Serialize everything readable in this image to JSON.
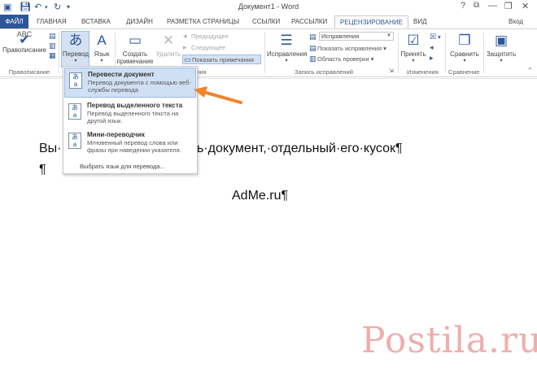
{
  "window": {
    "title": "Документ1 - Word",
    "help": "?",
    "minimize": "—",
    "restore": "❐",
    "close": "✕"
  },
  "quick_access": {
    "save_icon": "save-icon",
    "undo_icon": "undo-icon",
    "redo_icon": "redo-icon",
    "customize_icon": "chevron-down-icon"
  },
  "tabs": [
    {
      "label": "ФАЙЛ"
    },
    {
      "label": "ГЛАВНАЯ"
    },
    {
      "label": "ВСТАВКА"
    },
    {
      "label": "ДИЗАЙН"
    },
    {
      "label": "РАЗМЕТКА СТРАНИЦЫ"
    },
    {
      "label": "ССЫЛКИ"
    },
    {
      "label": "РАССЫЛКИ"
    },
    {
      "label": "РЕЦЕНЗИРОВАНИЕ"
    },
    {
      "label": "ВИД"
    }
  ],
  "user": {
    "label": "Вход"
  },
  "ribbon": {
    "spelling": {
      "label": "Правописание",
      "badge": "ABC"
    },
    "translate": {
      "label": "Перевод"
    },
    "language": {
      "label": "Язык"
    },
    "new_comment": {
      "label1": "Создать",
      "label2": "примечание"
    },
    "delete": {
      "label": "Удалить"
    },
    "prev": {
      "label": "Предыдущее"
    },
    "next": {
      "label": "Следующее"
    },
    "show_comments": {
      "label": "Показать примечания"
    },
    "track_changes": {
      "label": "Исправления"
    },
    "markup_combo": {
      "value": "Исправления"
    },
    "show_markup": {
      "label": "Показать исправления"
    },
    "review_pane": {
      "label": "Область проверки"
    },
    "accept": {
      "label": "Принять"
    },
    "compare": {
      "label": "Сравнить"
    },
    "protect": {
      "label": "Защитить"
    },
    "groups": {
      "proofing": "Правописание",
      "comments_tail": "ения",
      "tracking": "Запись исправлений",
      "changes": "Изменения",
      "compare": "Сравнение"
    }
  },
  "menu": {
    "items": [
      {
        "title": "Перевести документ",
        "desc": "Перевод документа с помощью веб-службы перевода"
      },
      {
        "title": "Перевод выделенного текста",
        "desc": "Перевод выделенного текста на другой язык."
      },
      {
        "title": "Мини-переводчик",
        "desc": "Мгновенный перевод слова или фразы при наведении указателя."
      }
    ],
    "choose_language": "Выбрать язык для перевода..."
  },
  "document": {
    "line1_prefix": "Вы·",
    "line1_suffix": "ь·документ,·отдельный·его·кусок¶",
    "line2": "¶",
    "line3": "AdMe.ru¶"
  },
  "watermark": {
    "text": "Postila.ru"
  },
  "colors": {
    "accent": "#2b579a",
    "arrow": "#f0852d"
  }
}
